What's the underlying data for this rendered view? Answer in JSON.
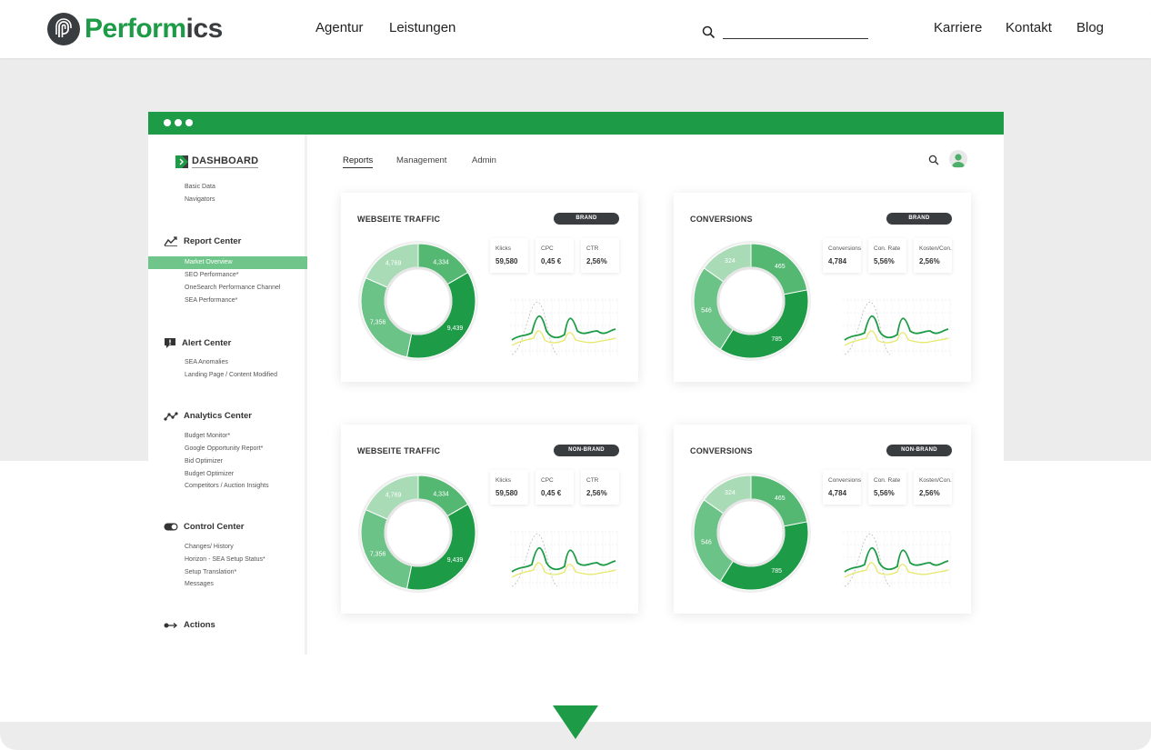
{
  "site": {
    "logo_green": "Perform",
    "logo_dark": "ics",
    "nav_left": [
      "Agentur",
      "Leistungen"
    ],
    "nav_right": [
      "Karriere",
      "Kontakt",
      "Blog"
    ],
    "brand_color": "#1d9b47",
    "dark_color": "#3a3d40"
  },
  "dashboard": {
    "title": "DASHBOARD",
    "basic_items": [
      "Basic Data",
      "Navigators"
    ],
    "report_center": {
      "label": "Report Center",
      "items": [
        "Market Overview",
        "SEO Performance*",
        "OneSearch Performance Channel",
        "SEA Performance*"
      ]
    },
    "alert_center": {
      "label": "Alert Center",
      "items": [
        "SEA Anomalies",
        "Landing Page / Content Modified"
      ]
    },
    "analytics_center": {
      "label": "Analytics Center",
      "items": [
        "Budget Monitor*",
        "Google Opportunity Report*",
        "Bid Optimizer",
        "Budget Optimizer",
        "Competitors / Auction Insights"
      ]
    },
    "control_center": {
      "label": "Control Center",
      "items": [
        "Changes/ History",
        "Horizon - SEA Setup Status*",
        "Setup Translation*",
        "Messages"
      ]
    },
    "actions": {
      "label": "Actions"
    },
    "tabs": [
      "Reports",
      "Management",
      "Admin"
    ]
  },
  "cards": [
    {
      "title": "WEBSEITE TRAFFIC",
      "badge": "BRAND",
      "stats": [
        {
          "k": "Klicks",
          "v": "59,580"
        },
        {
          "k": "CPC",
          "v": "0,45 €"
        },
        {
          "k": "CTR",
          "v": "2,56%"
        }
      ],
      "donut": [
        {
          "label": "4,334",
          "value": 4334
        },
        {
          "label": "9,439",
          "value": 9439
        },
        {
          "label": "7,356",
          "value": 7356
        },
        {
          "label": "4,769",
          "value": 4769
        }
      ]
    },
    {
      "title": "CONVERSIONS",
      "badge": "BRAND",
      "stats": [
        {
          "k": "Conversions",
          "v": "4,784"
        },
        {
          "k": "Con. Rate",
          "v": "5,56%"
        },
        {
          "k": "Kosten/Con.",
          "v": "2,56%"
        }
      ],
      "donut": [
        {
          "label": "465",
          "value": 465
        },
        {
          "label": "785",
          "value": 785
        },
        {
          "label": "546",
          "value": 546
        },
        {
          "label": "324",
          "value": 324
        }
      ]
    },
    {
      "title": "WEBSEITE TRAFFIC",
      "badge": "NON-BRAND",
      "stats": [
        {
          "k": "Klicks",
          "v": "59,580"
        },
        {
          "k": "CPC",
          "v": "0,45 €"
        },
        {
          "k": "CTR",
          "v": "2,56%"
        }
      ],
      "donut": [
        {
          "label": "4,334",
          "value": 4334
        },
        {
          "label": "9,439",
          "value": 9439
        },
        {
          "label": "7,356",
          "value": 7356
        },
        {
          "label": "4,769",
          "value": 4769
        }
      ]
    },
    {
      "title": "CONVERSIONS",
      "badge": "NON-BRAND",
      "stats": [
        {
          "k": "Conversions",
          "v": "4,784"
        },
        {
          "k": "Con. Rate",
          "v": "5,56%"
        },
        {
          "k": "Kosten/Con.",
          "v": "2,56%"
        }
      ],
      "donut": [
        {
          "label": "465",
          "value": 465
        },
        {
          "label": "785",
          "value": 785
        },
        {
          "label": "546",
          "value": 546
        },
        {
          "label": "324",
          "value": 324
        }
      ]
    }
  ]
}
